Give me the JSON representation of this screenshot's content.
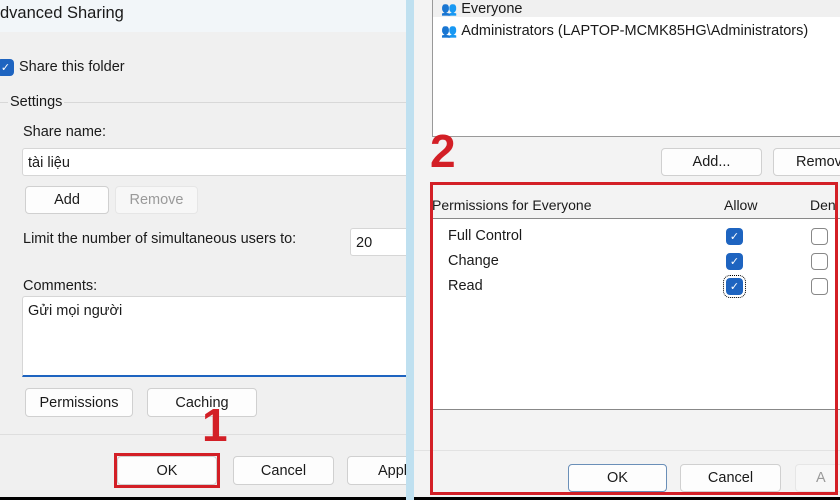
{
  "left_dialog": {
    "title": "dvanced Sharing",
    "share_checkbox": {
      "label": "Share this folder",
      "checked": true
    },
    "settings_label": "Settings",
    "share_name_label": "Share name:",
    "share_name_value": "tài liệu",
    "add_label": "Add",
    "remove_label": "Remove",
    "limit_label": "Limit the number of simultaneous users to:",
    "limit_value": "20",
    "comments_label": "Comments:",
    "comments_value": "Gửi mọi người",
    "permissions_label": "Permissions",
    "caching_label": "Caching",
    "ok_label": "OK",
    "cancel_label": "Cancel",
    "apply_label": "Appl"
  },
  "right_dialog": {
    "users": [
      {
        "name": "Everyone",
        "icon": "users-icon"
      },
      {
        "name": "Administrators (LAPTOP-MCMK85HG\\Administrators)",
        "icon": "users-icon"
      }
    ],
    "add_label": "Add...",
    "remove_label": "Remov",
    "permissions_header": "Permissions for Everyone",
    "allow_header": "Allow",
    "deny_header": "Den",
    "permissions": [
      {
        "name": "Full Control",
        "allow": true,
        "deny": false
      },
      {
        "name": "Change",
        "allow": true,
        "deny": false
      },
      {
        "name": "Read",
        "allow": true,
        "deny": false
      }
    ],
    "ok_label": "OK",
    "cancel_label": "Cancel",
    "apply_label": "A"
  },
  "annotations": {
    "step1": "1",
    "step2": "2",
    "highlight_color": "#d31f26"
  },
  "colors": {
    "accent": "#1e64c0",
    "divider": "#bfe0f0"
  }
}
